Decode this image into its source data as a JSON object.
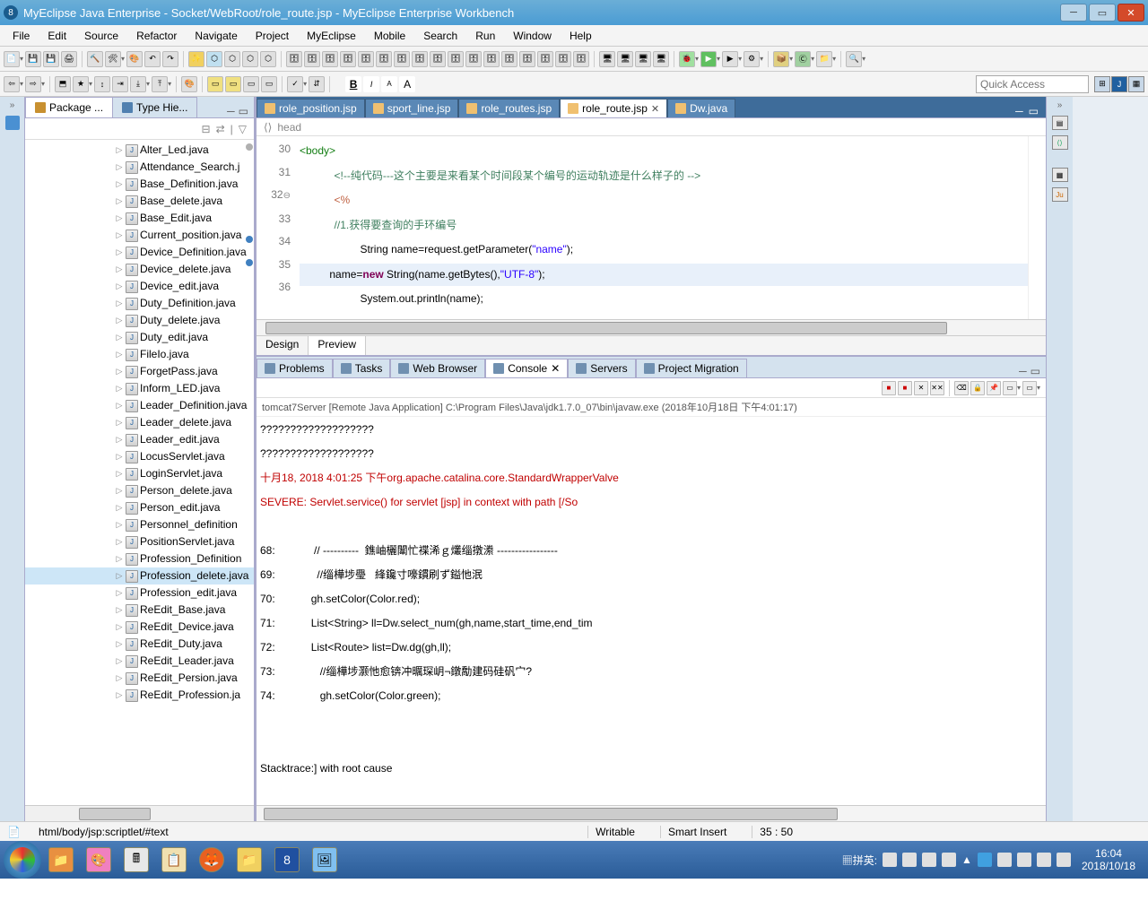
{
  "title": "MyEclipse Java Enterprise - Socket/WebRoot/role_route.jsp - MyEclipse Enterprise Workbench",
  "menu": [
    "File",
    "Edit",
    "Source",
    "Refactor",
    "Navigate",
    "Project",
    "MyEclipse",
    "Mobile",
    "Search",
    "Run",
    "Window",
    "Help"
  ],
  "quickaccess_placeholder": "Quick Access",
  "leftTabs": [
    {
      "label": "Package ...",
      "icon": "package-icon",
      "active": true
    },
    {
      "label": "Type Hie...",
      "icon": "type-icon",
      "active": false
    }
  ],
  "packageFiles": [
    "Alter_Led.java",
    "Attendance_Search.j",
    "Base_Definition.java",
    "Base_delete.java",
    "Base_Edit.java",
    "Current_position.java",
    "Device_Definition.java",
    "Device_delete.java",
    "Device_edit.java",
    "Duty_Definition.java",
    "Duty_delete.java",
    "Duty_edit.java",
    "FileIo.java",
    "ForgetPass.java",
    "Inform_LED.java",
    "Leader_Definition.java",
    "Leader_delete.java",
    "Leader_edit.java",
    "LocusServlet.java",
    "LoginServlet.java",
    "Person_delete.java",
    "Person_edit.java",
    "Personnel_definition",
    "PositionServlet.java",
    "Profession_Definition",
    "Profession_delete.java",
    "Profession_edit.java",
    "ReEdit_Base.java",
    "ReEdit_Device.java",
    "ReEdit_Duty.java",
    "ReEdit_Leader.java",
    "ReEdit_Persion.java",
    "ReEdit_Profession.ja"
  ],
  "selectedFile": "Profession_delete.java",
  "editorTabs": [
    {
      "label": "role_position.jsp",
      "active": false
    },
    {
      "label": "sport_line.jsp",
      "active": false
    },
    {
      "label": "role_routes.jsp",
      "active": false
    },
    {
      "label": "role_route.jsp",
      "active": true
    },
    {
      "label": "Dw.java",
      "active": false
    }
  ],
  "outlineCrumb": "head",
  "codeLines": {
    "l30": "<body>",
    "l31_cmt": "<!--纯代码---这个主要是来看某个时间段某个编号的运动轨迹是什么样子的 -->",
    "l32": "<%",
    "l33": "//1.获得要查询的手环编号",
    "l34_a": "String name=request.getParameter(",
    "l34_b": "\"name\"",
    "l34_c": ");",
    "l35_a": "name=",
    "l35_kw": "new",
    "l35_b": " String(name.getBytes(),",
    "l35_c": "\"UTF-8\"",
    "l35_d": ");",
    "l36": "System.out.println(name);"
  },
  "lineNumbers": [
    "30",
    "31",
    "32",
    "33",
    "34",
    "35",
    "36"
  ],
  "designTabs": [
    "Design",
    "Preview"
  ],
  "bottomTabs": [
    {
      "label": "Problems"
    },
    {
      "label": "Tasks"
    },
    {
      "label": "Web Browser"
    },
    {
      "label": "Console",
      "active": true,
      "closable": true
    },
    {
      "label": "Servers"
    },
    {
      "label": "Project Migration"
    }
  ],
  "consoleHeader": "tomcat7Server [Remote Java Application] C:\\Program Files\\Java\\jdk1.7.0_07\\bin\\javaw.exe (2018年10月18日 下午4:01:17)",
  "console": {
    "l1": "???????????????????",
    "l2": "???????????????????",
    "l3": "十月18, 2018 4:01:25 下午org.apache.catalina.core.StandardWrapperValve",
    "l4": "SEVERE: Servlet.service() for servlet [jsp] in context with path [/So",
    "l5": "",
    "l6": "68:             // ----------  鐎岫欐闈忙褋浠ｇ爜缁撴潫 -----------------",
    "l7": "69:              //缁樺埗璺   綘鑱寸嚎鏆刷ず鎰忚泯",
    "l8": "70:            gh.setColor(Color.red);",
    "l9": "71:            List<String> ll=Dw.select_num(gh,name,start_time,end_tim",
    "l10": "72:            List<Route> list=Dw.dg(gh,ll);",
    "l11": "73:               //缁樺埗灏忚愈锛冲曞琛岄¬鐓勪建码硅矾宀?",
    "l12": "74:               gh.setColor(Color.green);",
    "l13": "",
    "l14": "",
    "l15": "Stacktrace:] with root cause"
  },
  "status": {
    "path": "html/body/jsp:scriptlet/#text",
    "mode": "Writable",
    "insert": "Smart Insert",
    "pos": "35 : 50"
  },
  "ime": "▦拼英:",
  "clock": {
    "time": "16:04",
    "date": "2018/10/18"
  }
}
